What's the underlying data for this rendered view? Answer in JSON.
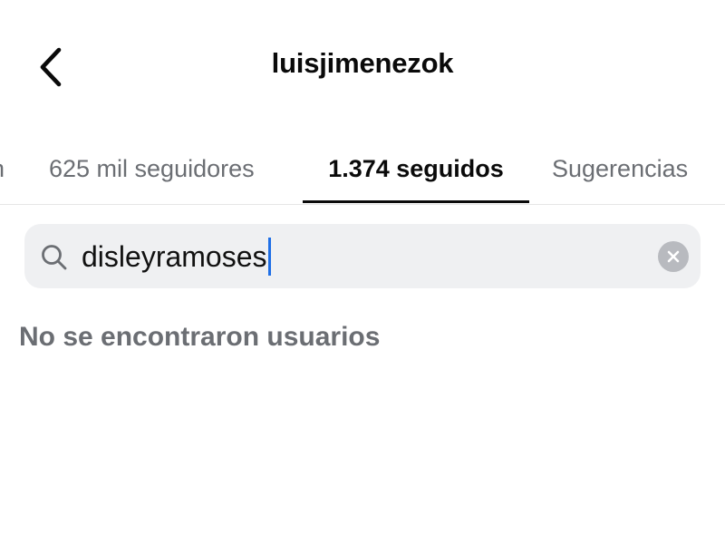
{
  "header": {
    "username": "luisjimenezok",
    "back_icon": "chevron-left-icon"
  },
  "tabs": {
    "partial_label": "n",
    "followers_label": "625 mil seguidores",
    "following_label": "1.374 seguidos",
    "suggestions_label": "Sugerencias",
    "active": "following"
  },
  "search": {
    "value": "disleyramoses",
    "search_icon": "search-icon",
    "clear_icon": "clear-icon"
  },
  "results": {
    "empty_message": "No se encontraron usuarios"
  },
  "colors": {
    "text_primary": "#0a0a0a",
    "text_secondary": "#6b6e73",
    "search_bg": "#eff0f2",
    "caret": "#1f6fe6",
    "clear_bg": "#b8babf"
  }
}
